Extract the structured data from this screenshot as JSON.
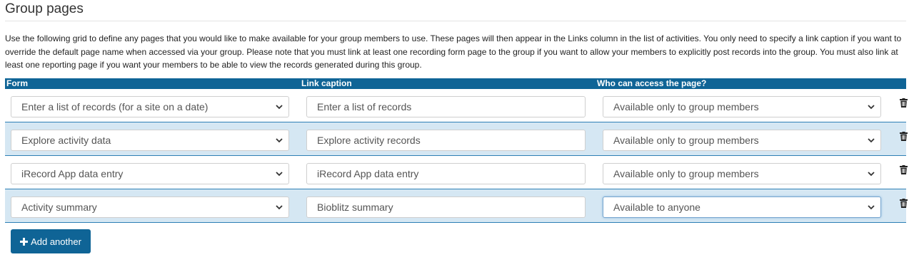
{
  "page": {
    "title": "Group pages",
    "intro": "Use the following grid to define any pages that you would like to make available for your group members to use. These pages will then appear in the Links column in the list of activities. You only need to specify a link caption if you want to override the default page name when accessed via your group. Please note that you must link at least one recording form page to the group if you want to allow your members to explicitly post records into the group. You must also link at least one reporting page if you want your members to be able to view the records generated during this group."
  },
  "grid": {
    "headers": {
      "form": "Form",
      "caption": "Link caption",
      "access": "Who can access the page?"
    },
    "rows": [
      {
        "form": "Enter a list of records (for a site on a date)",
        "caption": "Enter a list of records",
        "access": "Available only to group members"
      },
      {
        "form": "Explore activity data",
        "caption": "Explore activity records",
        "access": "Available only to group members"
      },
      {
        "form": "iRecord App data entry",
        "caption": "iRecord App data entry",
        "access": "Available only to group members"
      },
      {
        "form": "Activity summary",
        "caption": "Bioblitz summary",
        "access": "Available to anyone"
      }
    ]
  },
  "actions": {
    "add_label": "Add another"
  },
  "colors": {
    "header_blue": "#0f6496",
    "row_alt": "#d5e7f3"
  }
}
